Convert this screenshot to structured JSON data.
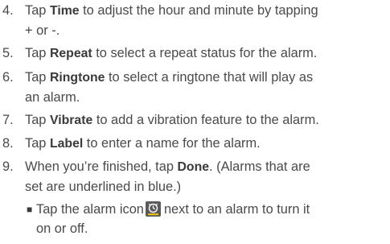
{
  "steps": [
    {
      "number": "4.",
      "pre": "Tap ",
      "bold": "Time",
      "post": " to adjust the hour and minute by tapping\n+ or -."
    },
    {
      "number": "5.",
      "pre": "Tap ",
      "bold": "Repeat",
      "post": " to select a repeat status for the alarm."
    },
    {
      "number": "6.",
      "pre": "Tap ",
      "bold": "Ringtone",
      "post": " to select a ringtone that will play as\nan alarm."
    },
    {
      "number": "7.",
      "pre": "Tap ",
      "bold": "Vibrate",
      "post": " to add a vibration feature to the alarm."
    },
    {
      "number": "8.",
      "pre": "Tap ",
      "bold": "Label",
      "post": " to enter a name for the alarm."
    },
    {
      "number": "9.",
      "pre": "When you’re finished, tap ",
      "bold": "Done",
      "post": ". (Alarms that are\nset are underlined in blue.)"
    }
  ],
  "sub_bullet": {
    "marker": "■",
    "pre": "Tap the alarm icon",
    "icon": "alarm-clock-icon",
    "post": "next to an alarm to turn it\non or off."
  },
  "colors": {
    "text": "#4a4a4a",
    "icon_background": "#5a5a5a",
    "icon_accent": "#f0c814"
  }
}
